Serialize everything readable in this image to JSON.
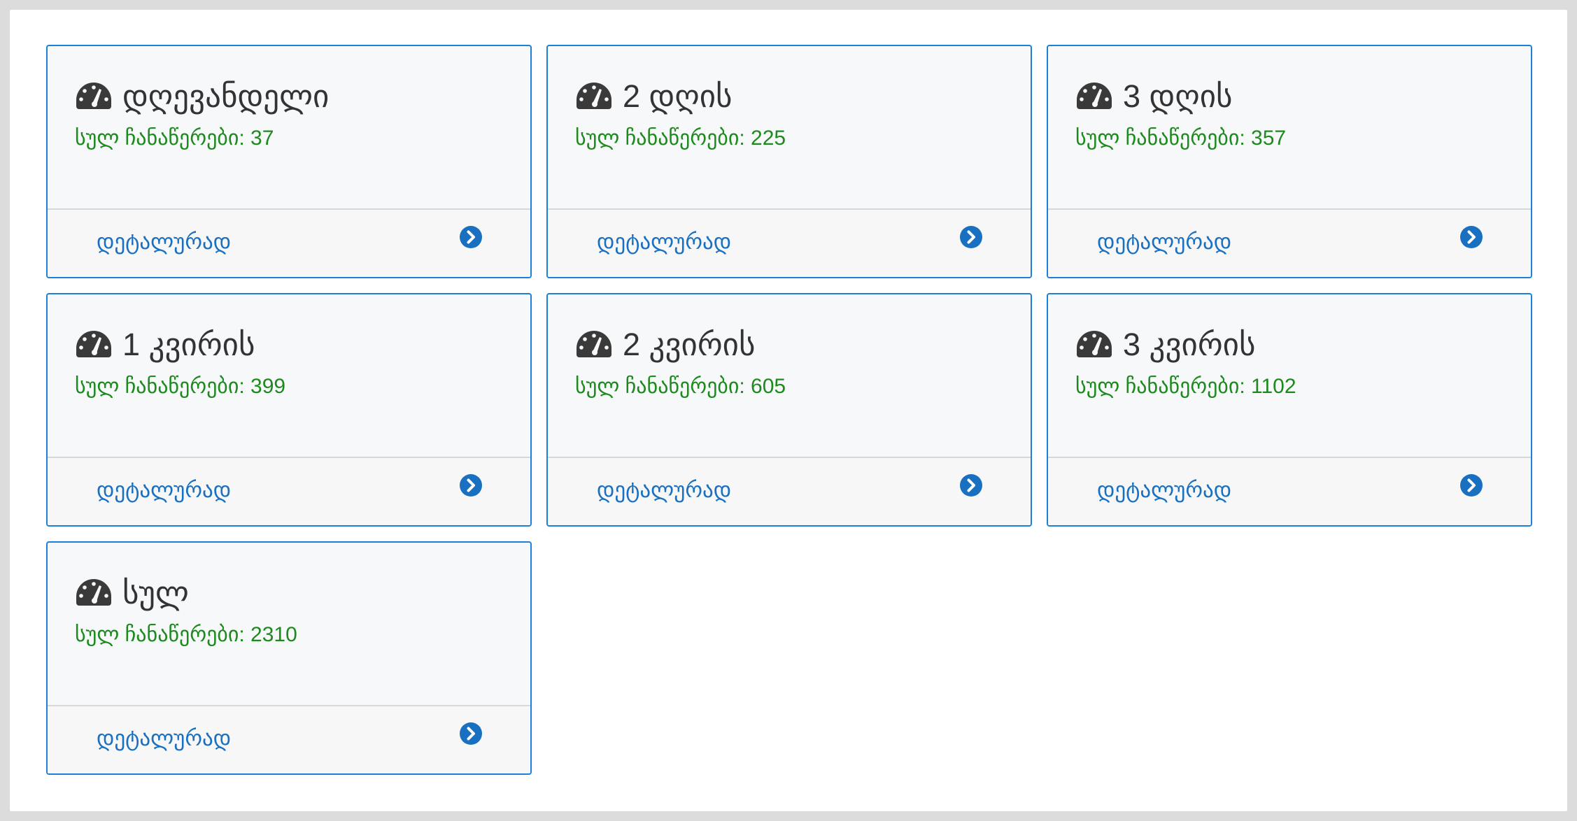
{
  "colors": {
    "accent": "#1e7fd6",
    "link": "#1a70c0",
    "total_text": "#1d8a1d",
    "title_text": "#333333",
    "card_bg": "#f7f8fa"
  },
  "cards": [
    {
      "title": "დღევანდელი",
      "total": "სულ ჩანაწერები: 37",
      "link": "დეტალურად",
      "icon": "gauge-icon",
      "action_icon": "chevron-circle-right-icon"
    },
    {
      "title": "2 დღის",
      "total": "სულ ჩანაწერები: 225",
      "link": "დეტალურად",
      "icon": "gauge-icon",
      "action_icon": "chevron-circle-right-icon"
    },
    {
      "title": "3 დღის",
      "total": "სულ ჩანაწერები: 357",
      "link": "დეტალურად",
      "icon": "gauge-icon",
      "action_icon": "chevron-circle-right-icon"
    },
    {
      "title": "1 კვირის",
      "total": "სულ ჩანაწერები: 399",
      "link": "დეტალურად",
      "icon": "gauge-icon",
      "action_icon": "chevron-circle-right-icon"
    },
    {
      "title": "2 კვირის",
      "total": "სულ ჩანაწერები: 605",
      "link": "დეტალურად",
      "icon": "gauge-icon",
      "action_icon": "chevron-circle-right-icon"
    },
    {
      "title": "3 კვირის",
      "total": "სულ ჩანაწერები: 1102",
      "link": "დეტალურად",
      "icon": "gauge-icon",
      "action_icon": "chevron-circle-right-icon"
    },
    {
      "title": "სულ",
      "total": "სულ ჩანაწერები: 2310",
      "link": "დეტალურად",
      "icon": "gauge-icon",
      "action_icon": "chevron-circle-right-icon"
    }
  ]
}
